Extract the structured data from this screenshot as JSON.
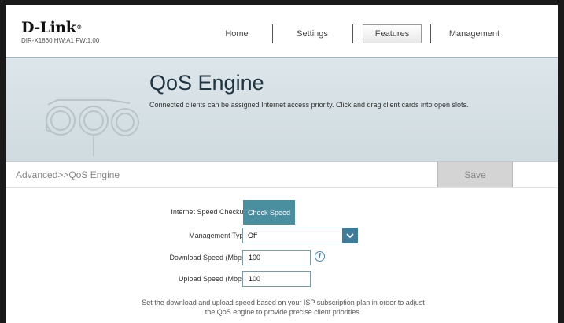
{
  "brand": {
    "logo": "D-Link",
    "model": "DIR-X1860 HW:A1 FW:1.00"
  },
  "nav": {
    "home": "Home",
    "settings": "Settings",
    "features": "Features",
    "management": "Management"
  },
  "banner": {
    "title": "QoS Engine",
    "description": "Connected clients can be assigned Internet access priority. Click and drag client cards into open slots."
  },
  "breadcrumb": "Advanced>>QoS Engine",
  "save_label": "Save",
  "form": {
    "speed_checkup_label": "Internet Speed Checkup:",
    "check_speed_button": "Check Speed",
    "management_type_label": "Management Type:",
    "management_type_value": "Off",
    "download_label": "Download Speed (Mbps):",
    "download_value": "100",
    "upload_label": "Upload Speed (Mbps):",
    "upload_value": "100",
    "info_icon": "i",
    "note_line1": "Set the download and upload speed based on your ISP subscription plan in order to adjust",
    "note_line2": "the QoS engine to provide precise client priorities."
  },
  "colors": {
    "accent": "#4a8fa0",
    "select_arrow": "#3d7d9a",
    "banner_bg": "#d6e0e5",
    "save_bg": "#d4d4d4"
  }
}
